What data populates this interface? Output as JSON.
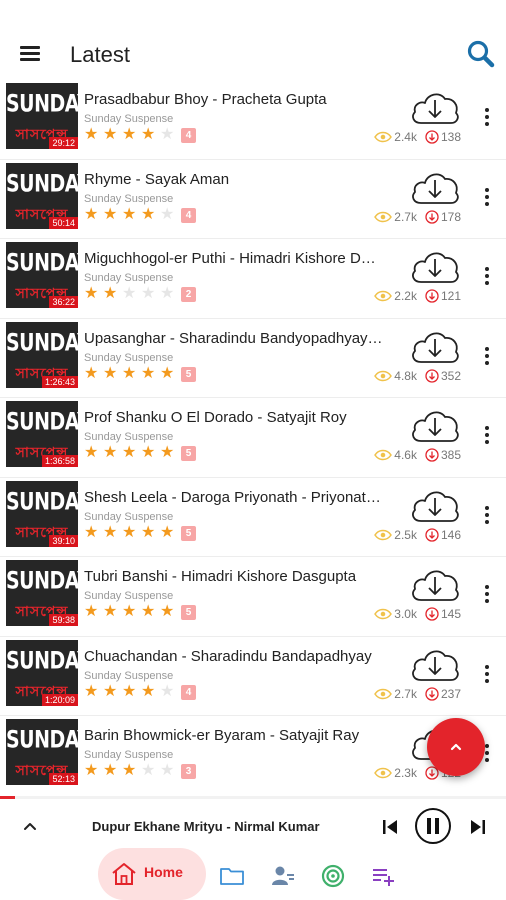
{
  "appbar": {
    "title": "Latest",
    "menu_icon": "hamburger-menu-icon",
    "search_icon": "search-icon"
  },
  "colors": {
    "accent": "#e3242b",
    "star": "#f39a1e",
    "star_off": "#e6e6e6",
    "eye": "#f0c24b",
    "badge": "#f7a6a6"
  },
  "episodes": [
    {
      "title": "Prasadbabur Bhoy - Pracheta Gupta",
      "subtitle": "Sunday Suspense",
      "rating": 4,
      "rating_badge": "4",
      "duration": "29:12",
      "views": "2.4k",
      "downloads": "138"
    },
    {
      "title": "Rhyme - Sayak Aman",
      "subtitle": "Sunday Suspense",
      "rating": 4,
      "rating_badge": "4",
      "duration": "50:14",
      "views": "2.7k",
      "downloads": "178"
    },
    {
      "title": "Miguchhogol-er Puthi - Himadri Kishore Dasgupta",
      "subtitle": "Sunday Suspense",
      "rating": 2,
      "rating_badge": "2",
      "duration": "36:22",
      "views": "2.2k",
      "downloads": "121"
    },
    {
      "title": "Upasanghar - Sharadindu Bandyopadhyay - Byomkesh",
      "subtitle": "Sunday Suspense",
      "rating": 5,
      "rating_badge": "5",
      "duration": "1:26:43",
      "views": "4.8k",
      "downloads": "352"
    },
    {
      "title": "Prof Shanku O El Dorado - Satyajit Roy",
      "subtitle": "Sunday Suspense",
      "rating": 5,
      "rating_badge": "5",
      "duration": "1:36:58",
      "views": "4.6k",
      "downloads": "385"
    },
    {
      "title": "Shesh Leela - Daroga Priyonath - Priyonath Mukhopadhyay",
      "subtitle": "Sunday Suspense",
      "rating": 5,
      "rating_badge": "5",
      "duration": "39:10",
      "views": "2.5k",
      "downloads": "146"
    },
    {
      "title": "Tubri Banshi - Himadri Kishore Dasgupta",
      "subtitle": "Sunday Suspense",
      "rating": 5,
      "rating_badge": "5",
      "duration": "59:38",
      "views": "3.0k",
      "downloads": "145"
    },
    {
      "title": "Chuachandan - Sharadindu Bandapadhyay",
      "subtitle": "Sunday Suspense",
      "rating": 4,
      "rating_badge": "4",
      "duration": "1:20:09",
      "views": "2.7k",
      "downloads": "237"
    },
    {
      "title": "Barin Bhowmick-er Byaram - Satyajit Ray",
      "subtitle": "Sunday Suspense",
      "rating": 3,
      "rating_badge": "3",
      "duration": "52:13",
      "views": "2.3k",
      "downloads": "122"
    }
  ],
  "thumbnail": {
    "line1": "SUNDAY",
    "line2": "সাসপেন্স"
  },
  "player": {
    "title": "Dupur Ekhane Mrityu - Nirmal Kumar",
    "progress": 0.03,
    "state": "playing"
  },
  "nav": {
    "items": [
      {
        "label": "Home",
        "icon": "home-icon",
        "active": true
      },
      {
        "label": "",
        "icon": "folder-icon",
        "active": false
      },
      {
        "label": "",
        "icon": "artists-icon",
        "active": false
      },
      {
        "label": "",
        "icon": "radio-icon",
        "active": false
      },
      {
        "label": "",
        "icon": "playlist-add-icon",
        "active": false
      }
    ]
  },
  "fab_icon": "chevron-up-icon"
}
